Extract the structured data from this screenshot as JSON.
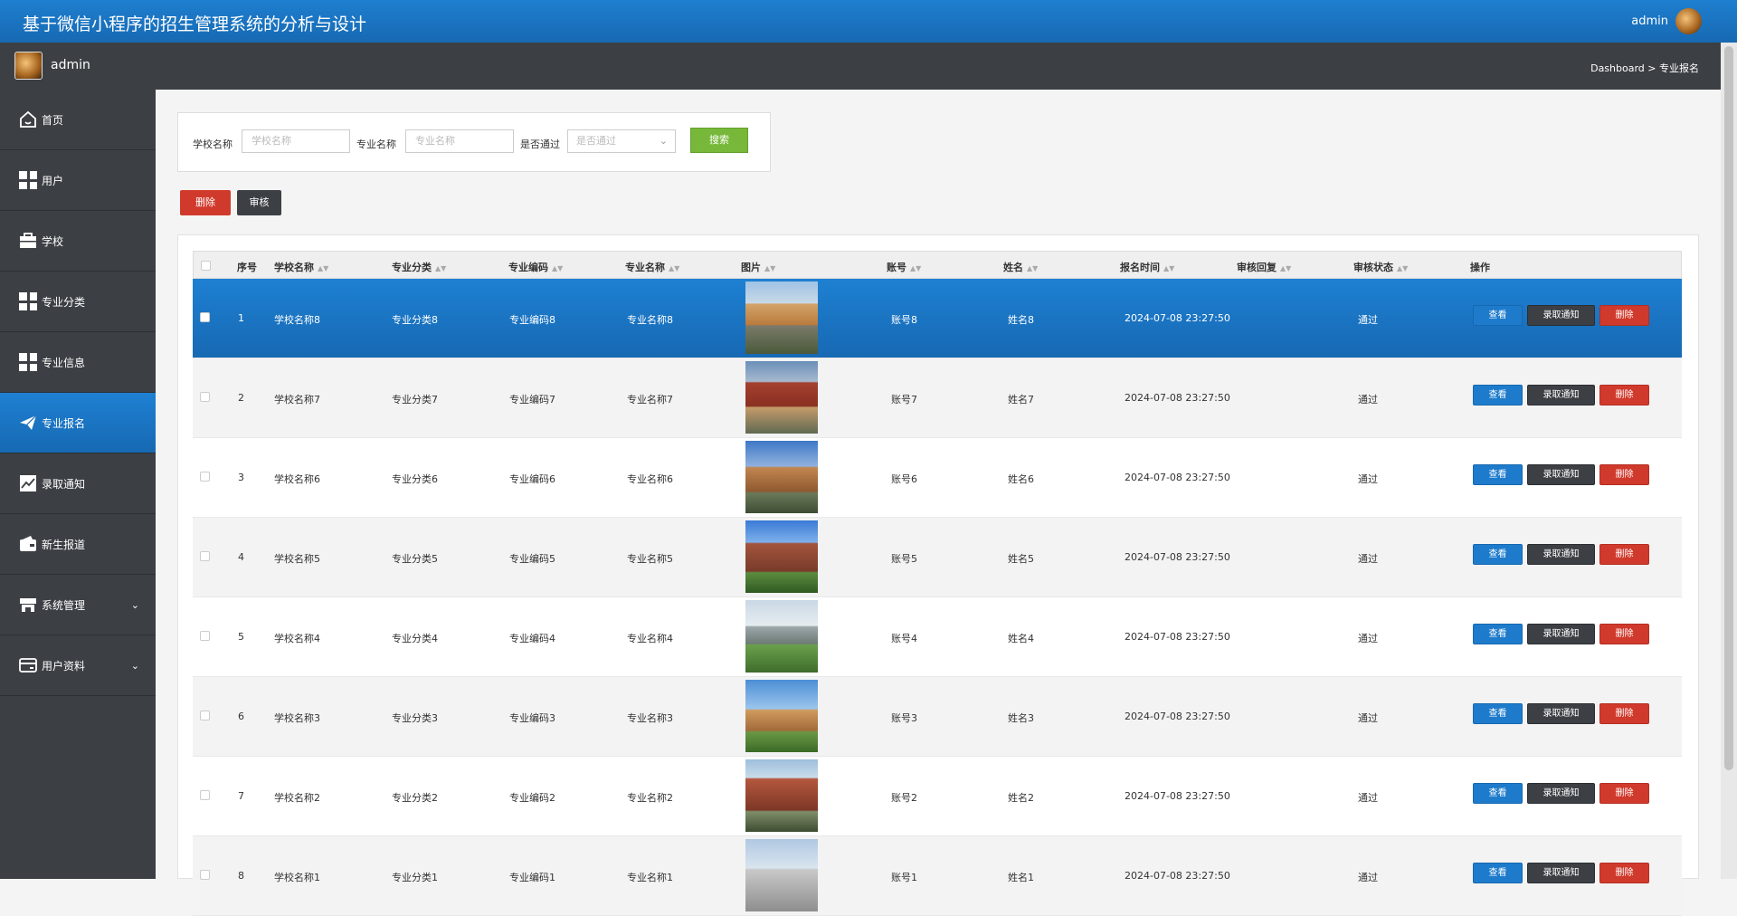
{
  "app": {
    "title": "基于微信小程序的招生管理系统的分析与设计",
    "top_user": "admin"
  },
  "subbar": {
    "user": "admin",
    "breadcrumb": "Dashboard > 专业报名"
  },
  "sidebar": {
    "items": [
      {
        "label": "首页",
        "icon": "home-icon"
      },
      {
        "label": "用户",
        "icon": "grid-icon"
      },
      {
        "label": "学校",
        "icon": "briefcase-icon"
      },
      {
        "label": "专业分类",
        "icon": "grid-icon"
      },
      {
        "label": "专业信息",
        "icon": "grid-icon"
      },
      {
        "label": "专业报名",
        "icon": "send-icon"
      },
      {
        "label": "录取通知",
        "icon": "chart-icon"
      },
      {
        "label": "新生报道",
        "icon": "wallet-icon"
      },
      {
        "label": "系统管理",
        "icon": "store-icon"
      },
      {
        "label": "用户资料",
        "icon": "card-icon"
      }
    ]
  },
  "search": {
    "school_label": "学校名称",
    "school_placeholder": "学校名称",
    "major_label": "专业名称",
    "major_placeholder": "专业名称",
    "pass_label": "是否通过",
    "pass_placeholder": "是否通过",
    "search_button": "搜索"
  },
  "actions": {
    "delete": "删除",
    "audit": "审核"
  },
  "table": {
    "headers": [
      "序号",
      "学校名称",
      "专业分类",
      "专业编码",
      "专业名称",
      "图片",
      "账号",
      "姓名",
      "报名时间",
      "审核回复",
      "审核状态",
      "操作"
    ],
    "op_labels": {
      "view": "查看",
      "notice": "录取通知",
      "delete": "删除"
    },
    "rows": [
      {
        "no": "1",
        "school": "学校名称8",
        "category": "专业分类8",
        "code": "专业编码8",
        "major": "专业名称8",
        "account": "账号8",
        "name": "姓名8",
        "time": "2024-07-08 23:27:50",
        "reply": "",
        "status": "通过"
      },
      {
        "no": "2",
        "school": "学校名称7",
        "category": "专业分类7",
        "code": "专业编码7",
        "major": "专业名称7",
        "account": "账号7",
        "name": "姓名7",
        "time": "2024-07-08 23:27:50",
        "reply": "",
        "status": "通过"
      },
      {
        "no": "3",
        "school": "学校名称6",
        "category": "专业分类6",
        "code": "专业编码6",
        "major": "专业名称6",
        "account": "账号6",
        "name": "姓名6",
        "time": "2024-07-08 23:27:50",
        "reply": "",
        "status": "通过"
      },
      {
        "no": "4",
        "school": "学校名称5",
        "category": "专业分类5",
        "code": "专业编码5",
        "major": "专业名称5",
        "account": "账号5",
        "name": "姓名5",
        "time": "2024-07-08 23:27:50",
        "reply": "",
        "status": "通过"
      },
      {
        "no": "5",
        "school": "学校名称4",
        "category": "专业分类4",
        "code": "专业编码4",
        "major": "专业名称4",
        "account": "账号4",
        "name": "姓名4",
        "time": "2024-07-08 23:27:50",
        "reply": "",
        "status": "通过"
      },
      {
        "no": "6",
        "school": "学校名称3",
        "category": "专业分类3",
        "code": "专业编码3",
        "major": "专业名称3",
        "account": "账号3",
        "name": "姓名3",
        "time": "2024-07-08 23:27:50",
        "reply": "",
        "status": "通过"
      },
      {
        "no": "7",
        "school": "学校名称2",
        "category": "专业分类2",
        "code": "专业编码2",
        "major": "专业名称2",
        "account": "账号2",
        "name": "姓名2",
        "time": "2024-07-08 23:27:50",
        "reply": "",
        "status": "通过"
      },
      {
        "no": "8",
        "school": "学校名称1",
        "category": "专业分类1",
        "code": "专业编码1",
        "major": "专业名称1",
        "account": "账号1",
        "name": "姓名1",
        "time": "2024-07-08 23:27:50",
        "reply": "",
        "status": "通过"
      }
    ]
  }
}
